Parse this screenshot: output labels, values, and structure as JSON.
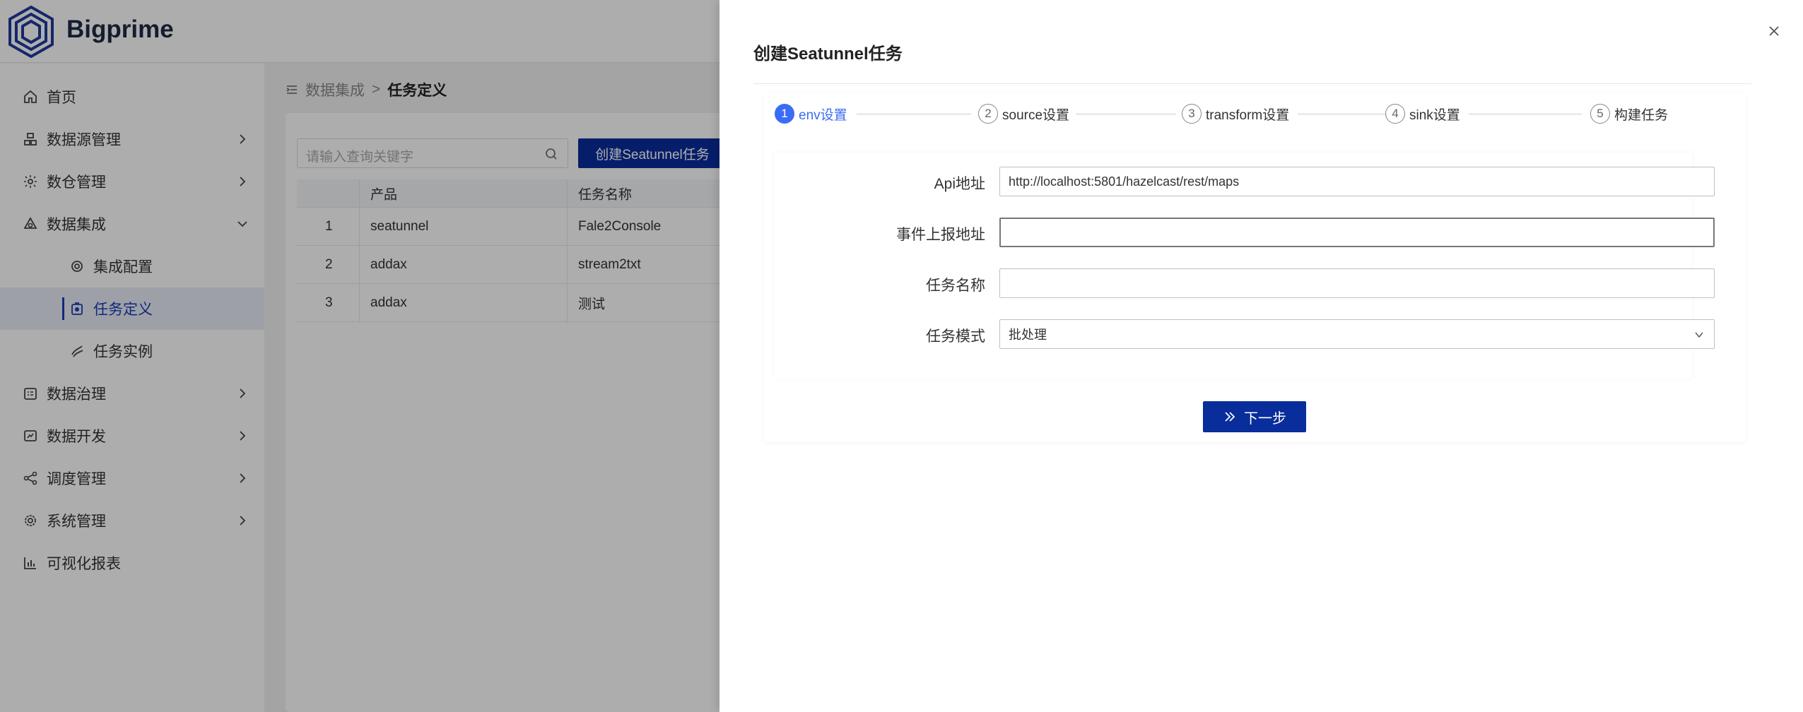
{
  "app": {
    "name": "Bigprime"
  },
  "sidebar": {
    "items": [
      {
        "label": "首页",
        "icon": "home-icon"
      },
      {
        "label": "数据源管理",
        "icon": "datasource-icon"
      },
      {
        "label": "数仓管理",
        "icon": "warehouse-icon"
      },
      {
        "label": "数据集成",
        "icon": "integration-icon"
      },
      {
        "label": "集成配置",
        "icon": "gear-icon"
      },
      {
        "label": "任务定义",
        "icon": "task-icon"
      },
      {
        "label": "任务实例",
        "icon": "instance-icon"
      },
      {
        "label": "数据治理",
        "icon": "governance-icon"
      },
      {
        "label": "数据开发",
        "icon": "dev-icon"
      },
      {
        "label": "调度管理",
        "icon": "share-icon"
      },
      {
        "label": "系统管理",
        "icon": "settings-icon"
      },
      {
        "label": "可视化报表",
        "icon": "chart-icon"
      }
    ]
  },
  "breadcrumb": {
    "parent": "数据集成",
    "current": "任务定义"
  },
  "toolbar": {
    "search_placeholder": "请输入查询关键字",
    "create_label": "创建Seatunnel任务"
  },
  "table": {
    "headers": [
      "",
      "产品",
      "任务名称"
    ],
    "rows": [
      {
        "idx": "1",
        "product": "seatunnel",
        "name": "Fale2Console"
      },
      {
        "idx": "2",
        "product": "addax",
        "name": "stream2txt"
      },
      {
        "idx": "3",
        "product": "addax",
        "name": "测试"
      }
    ]
  },
  "drawer": {
    "title": "创建Seatunnel任务",
    "steps": [
      {
        "num": "1",
        "label": "env设置"
      },
      {
        "num": "2",
        "label": "source设置"
      },
      {
        "num": "3",
        "label": "transform设置"
      },
      {
        "num": "4",
        "label": "sink设置"
      },
      {
        "num": "5",
        "label": "构建任务"
      }
    ],
    "form": {
      "api_label": "Api地址",
      "api_value": "http://localhost:5801/hazelcast/rest/maps",
      "event_label": "事件上报地址",
      "event_value": "",
      "name_label": "任务名称",
      "name_value": "",
      "mode_label": "任务模式",
      "mode_value": "批处理"
    },
    "next_label": "下一步"
  },
  "colors": {
    "primary": "#0a2d9c",
    "step_active": "#3b6cf6",
    "menu_active_bg": "#e8ecf6"
  }
}
